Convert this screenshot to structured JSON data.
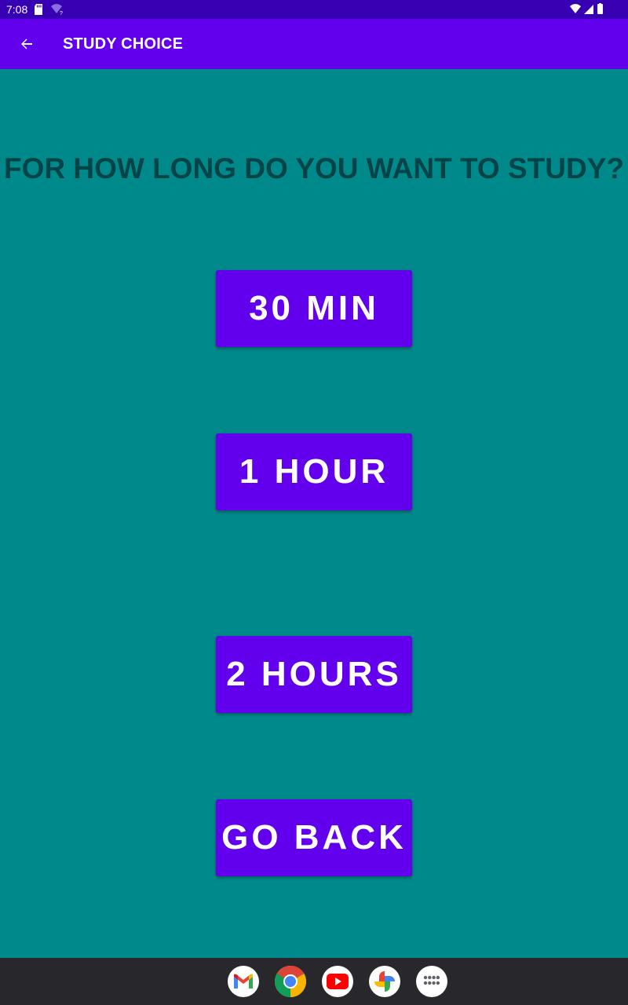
{
  "status_bar": {
    "time": "7:08",
    "icons": [
      "sd-card-icon",
      "wifi-question-icon",
      "wifi-icon",
      "cell-signal-icon",
      "battery-icon"
    ]
  },
  "app_bar": {
    "back_icon": "arrow-back-icon",
    "title": "STUDY CHOICE"
  },
  "main": {
    "question": "FOR HOW LONG DO YOU WANT TO STUDY?",
    "buttons": {
      "thirty_min": "30 MIN",
      "one_hour": "1 HOUR",
      "two_hours": "2 HOURS",
      "go_back": "GO BACK"
    }
  },
  "dock": {
    "apps": [
      "gmail-icon",
      "chrome-icon",
      "youtube-icon",
      "photos-icon",
      "app-drawer-icon"
    ]
  },
  "colors": {
    "background": "#00898a",
    "status_bar": "#3700b3",
    "app_bar": "#6200ee",
    "button": "#6200ee",
    "question_text": "#004447",
    "dock": "#28272b"
  }
}
